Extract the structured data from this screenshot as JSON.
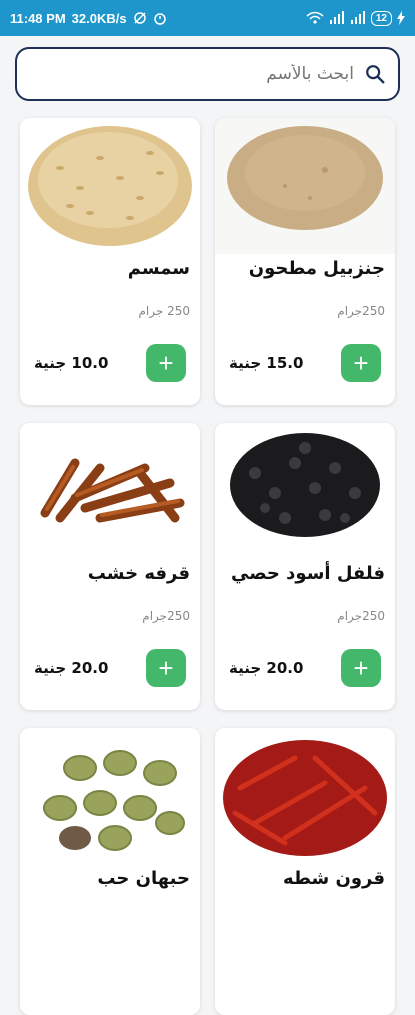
{
  "status": {
    "time": "11:48 PM",
    "speed": "32.0KB/s",
    "battery": "12"
  },
  "search": {
    "placeholder": "ابحث بالأسم"
  },
  "products": [
    {
      "name": "جنزبيل مطحون",
      "weight": "250جرام",
      "price": "15.0 جنية",
      "image": "ginger-powder"
    },
    {
      "name": "سمسم",
      "weight": "250 جرام",
      "price": "10.0 جنية",
      "image": "sesame"
    },
    {
      "name": "فلفل أسود حصي",
      "weight": "250جرام",
      "price": "20.0 جنية",
      "image": "black-pepper"
    },
    {
      "name": "قرفه خشب",
      "weight": "250جرام",
      "price": "20.0 جنية",
      "image": "cinnamon"
    },
    {
      "name": "قرون شطه",
      "weight": "",
      "price": "",
      "image": "red-chili"
    },
    {
      "name": "حبهان حب",
      "weight": "",
      "price": "",
      "image": "cardamom"
    }
  ],
  "colors": {
    "status_bar": "#1e96cc",
    "search_border": "#1c2f56",
    "add_button": "#44b86a"
  }
}
